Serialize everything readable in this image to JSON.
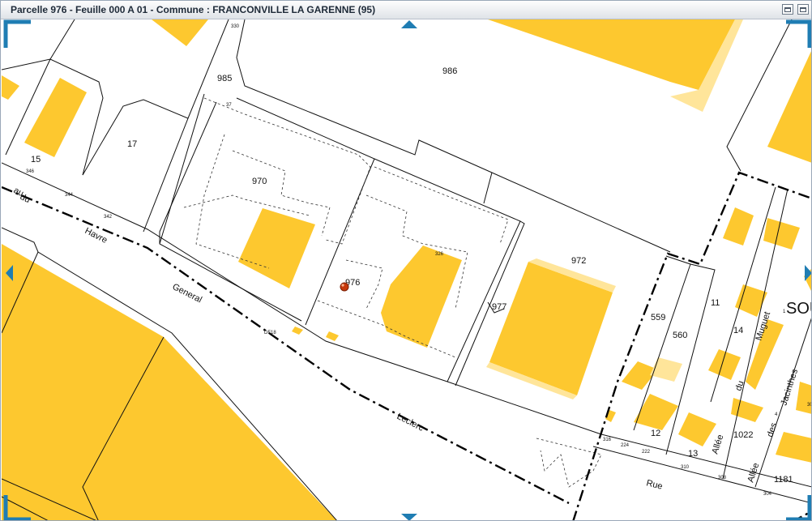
{
  "window": {
    "title": "Parcelle 976 - Feuille 000 A 01 - Commune : FRANCONVILLE LA GARENNE (95)"
  },
  "map": {
    "parcels": [
      "985",
      "986",
      "17",
      "15",
      "970",
      "976",
      "977",
      "972",
      "559",
      "560",
      "11",
      "14",
      "12",
      "13",
      "1022",
      "1181"
    ],
    "small_labels": [
      "330",
      "37",
      "326",
      "DF18",
      "346",
      "344",
      "342",
      "316",
      "224",
      "222",
      "310",
      "308",
      "304",
      "1",
      "4",
      "30"
    ],
    "streets": [
      {
        "words": [
          "du",
          "Havre"
        ]
      },
      {
        "words": [
          "au",
          "General",
          "Leclerc",
          "Rue"
        ]
      },
      {
        "words": [
          "Allée",
          "du",
          "Muguet"
        ]
      },
      {
        "words": [
          "Allée",
          "des",
          "Jacinthes"
        ]
      }
    ],
    "place_label": "SOU",
    "marker": "selected-parcel-marker",
    "colors": {
      "building": "#FDC82F",
      "building_light": "#FFE59A",
      "parcel_line": "#111111",
      "frame_accent": "#1F7DB3"
    }
  }
}
